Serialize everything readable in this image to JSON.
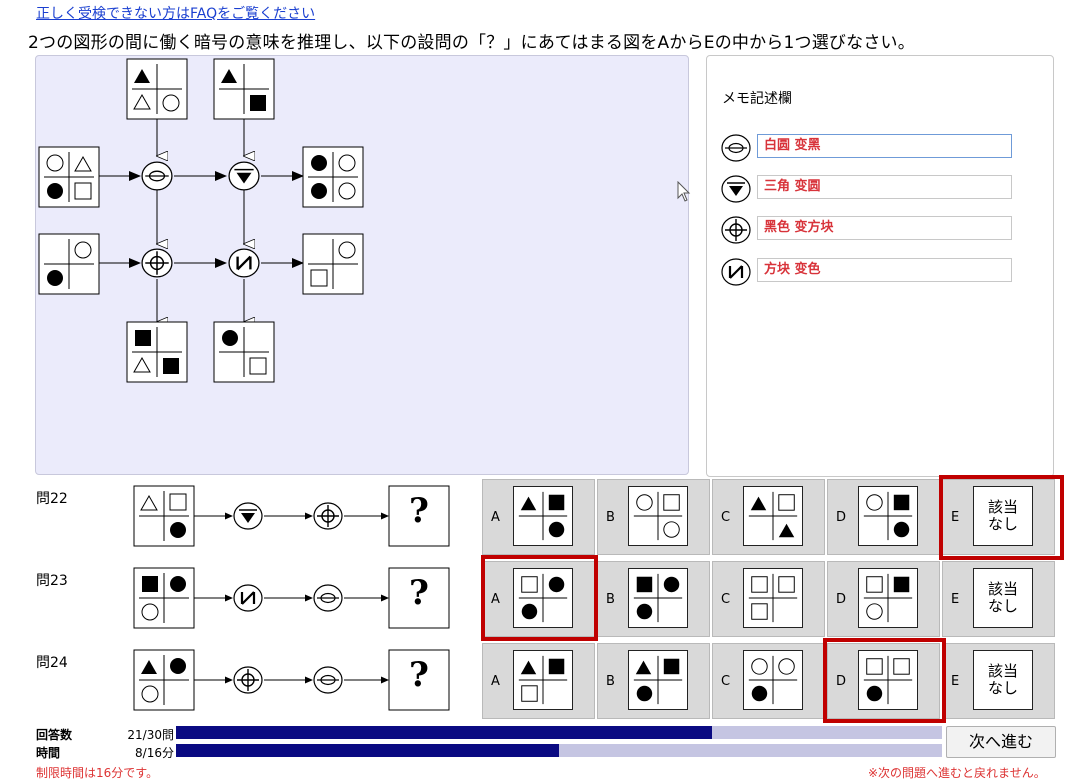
{
  "faq_link": "正しく受検できない方はFAQをご覧ください",
  "instruction": "2つの図形の間に働く暗号の意味を推理し、以下の設問の「？」にあてはまる図をAからEの中から1つ選びなさい。",
  "memo": {
    "title": "メモ記述欄",
    "entries": [
      {
        "icon": "eye-code-icon",
        "value": "白圆 变黑"
      },
      {
        "icon": "triangle-code-icon",
        "value": "三角 变圆"
      },
      {
        "icon": "crosshair-code-icon",
        "value": "黑色 变方块"
      },
      {
        "icon": "n-code-icon",
        "value": "方块 变色"
      }
    ]
  },
  "questions": [
    {
      "label": "問22",
      "unknown": "?",
      "choices": [
        {
          "letter": "A"
        },
        {
          "letter": "B"
        },
        {
          "letter": "C"
        },
        {
          "letter": "D"
        },
        {
          "letter": "E",
          "text": "該当なし",
          "line1": "該当",
          "line2": "なし",
          "selected": true
        }
      ]
    },
    {
      "label": "問23",
      "unknown": "?",
      "choices": [
        {
          "letter": "A",
          "selected": true
        },
        {
          "letter": "B"
        },
        {
          "letter": "C"
        },
        {
          "letter": "D"
        },
        {
          "letter": "E",
          "text": "該当なし",
          "line1": "該当",
          "line2": "なし"
        }
      ]
    },
    {
      "label": "問24",
      "unknown": "?",
      "choices": [
        {
          "letter": "A"
        },
        {
          "letter": "B"
        },
        {
          "letter": "C"
        },
        {
          "letter": "D",
          "selected": true
        },
        {
          "letter": "E",
          "text": "該当なし",
          "line1": "該当",
          "line2": "なし"
        }
      ]
    }
  ],
  "progress": {
    "answers_label": "回答数",
    "answers_value": "21/30問",
    "answers_fraction": 0.7,
    "time_label": "時間",
    "time_value": "8/16分",
    "time_fraction": 0.5
  },
  "next_button": "次へ進む",
  "time_limit_note": "制限時間は16分です。",
  "no_return_note": "※次の問題へ進むと戻れません。",
  "colors": {
    "selection": "#c00000",
    "progress_fill": "#0a0a82",
    "memo_text": "#d8333a"
  }
}
